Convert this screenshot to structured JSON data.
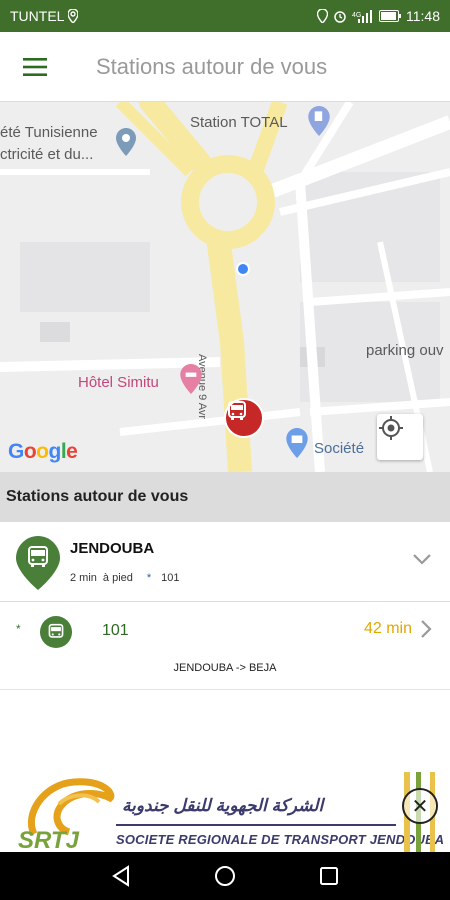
{
  "status_bar": {
    "carrier": "TUNTEL",
    "time": "11:48",
    "icons": [
      "location-icon",
      "alarm-icon",
      "signal-icon",
      "battery-icon"
    ]
  },
  "app_bar": {
    "title": "Stations autour de vous",
    "menu_icon": "hamburger-menu-icon"
  },
  "map": {
    "labels": {
      "company_line1": "été Tunisienne",
      "company_line2": "ctricité et du...",
      "station_total": "Station TOTAL",
      "avenue": "Avenue 9 Avr",
      "hotel": "Hôtel Simitu",
      "parking": "parking ouv",
      "societe": "Société"
    },
    "google": "Google",
    "colors": {
      "road": "#f7e9a0",
      "background": "#eeeeef",
      "bus_marker": "#c62828"
    }
  },
  "section": {
    "title": "Stations autour de vous"
  },
  "station": {
    "name": "JENDOUBA",
    "walk": "2 min",
    "walk_suffix": "à pied",
    "star": "*",
    "line": "101"
  },
  "route": {
    "star": "*",
    "number": "101",
    "eta": "42 min",
    "direction": "JENDOUBA -> BEJA"
  },
  "ad": {
    "arabic": "الشركة الجهوية للنقل جندوبة",
    "french": "SOCIETE REGIONALE DE TRANSPORT JENDOUBA",
    "logo_text": "SRTJ",
    "close": "✕"
  },
  "nav": {
    "back": "back-icon",
    "home": "home-icon",
    "recents": "recents-icon"
  }
}
